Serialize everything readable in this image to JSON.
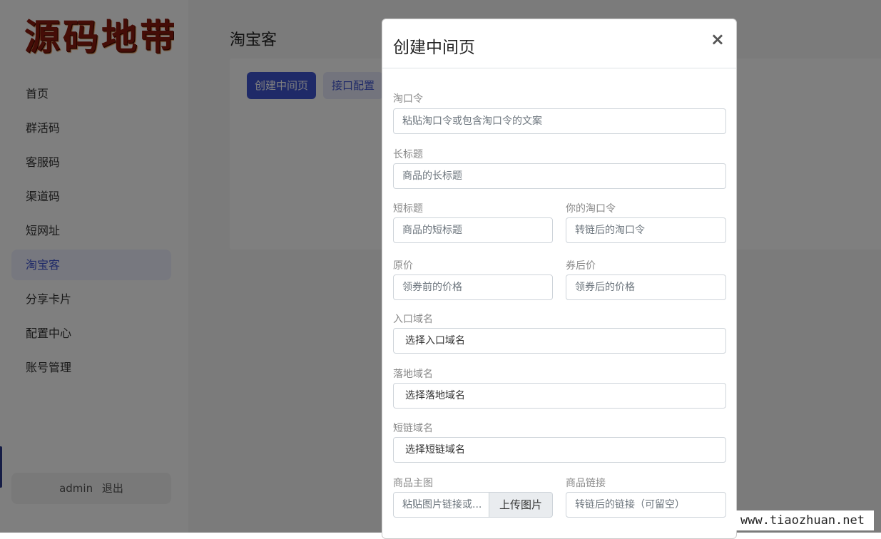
{
  "sidebar": {
    "logo_text": "源码地带",
    "items": [
      {
        "label": "首页"
      },
      {
        "label": "群活码"
      },
      {
        "label": "客服码"
      },
      {
        "label": "渠道码"
      },
      {
        "label": "短网址"
      },
      {
        "label": "淘宝客",
        "active": true
      },
      {
        "label": "分享卡片"
      },
      {
        "label": "配置中心"
      },
      {
        "label": "账号管理"
      }
    ],
    "user": {
      "name": "admin",
      "logout": "退出"
    }
  },
  "main": {
    "title": "淘宝客",
    "create_button": "创建中间页",
    "config_button": "接口配置"
  },
  "modal": {
    "title": "创建中间页",
    "close": "×",
    "fields": {
      "tkl": {
        "label": "淘口令",
        "placeholder": "粘贴淘口令或包含淘口令的文案"
      },
      "long_title": {
        "label": "长标题",
        "placeholder": "商品的长标题"
      },
      "short_title": {
        "label": "短标题",
        "placeholder": "商品的短标题"
      },
      "your_tkl": {
        "label": "你的淘口令",
        "placeholder": "转链后的淘口令"
      },
      "original_price": {
        "label": "原价",
        "placeholder": "领券前的价格"
      },
      "coupon_price": {
        "label": "券后价",
        "placeholder": "领券后的价格"
      },
      "entry_domain": {
        "label": "入口域名",
        "value": "选择入口域名"
      },
      "landing_domain": {
        "label": "落地域名",
        "value": "选择落地域名"
      },
      "short_domain": {
        "label": "短链域名",
        "value": "选择短链域名"
      },
      "main_image": {
        "label": "商品主图",
        "placeholder": "粘贴图片链接或...",
        "upload": "上传图片"
      },
      "product_link": {
        "label": "商品链接",
        "placeholder": "转链后的链接（可留空）"
      }
    }
  },
  "watermark": "www.tiaozhuan.net",
  "colors": {
    "accent": "#3f55d1",
    "active_bg": "#eef0ff",
    "logo": "#8b1a0e"
  }
}
